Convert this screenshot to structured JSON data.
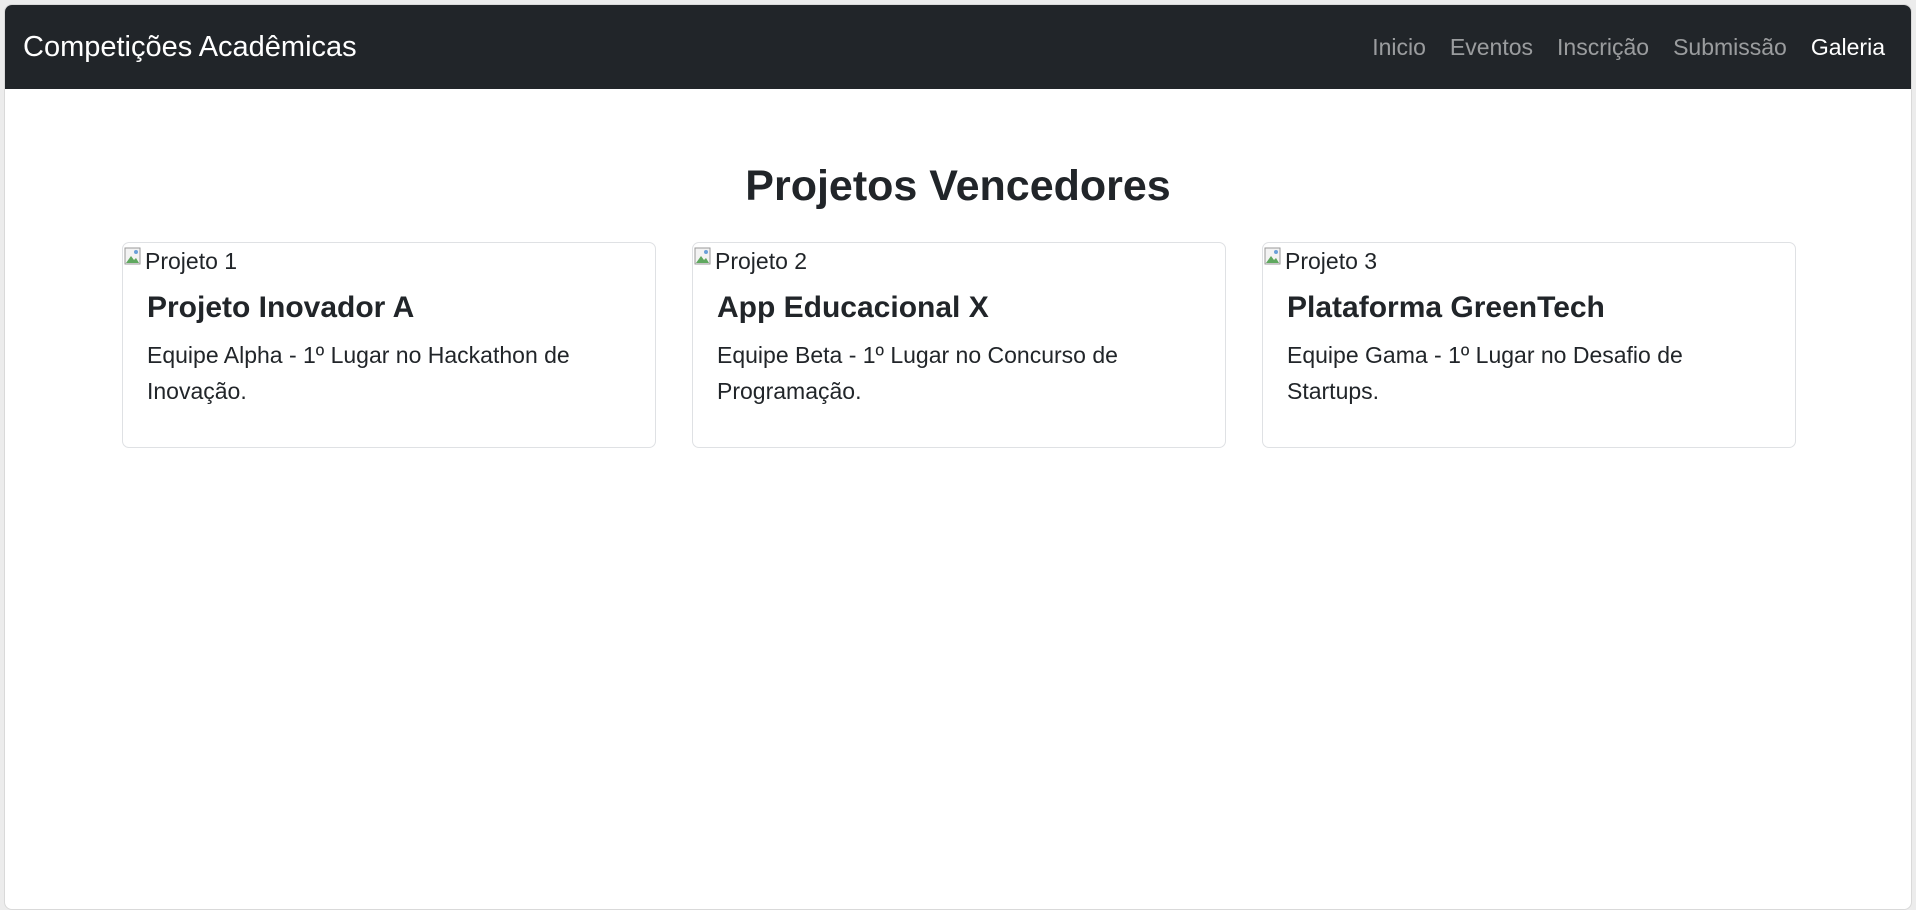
{
  "navbar": {
    "brand": "Competições Acadêmicas",
    "links": [
      {
        "label": "Inicio",
        "active": false
      },
      {
        "label": "Eventos",
        "active": false
      },
      {
        "label": "Inscrição",
        "active": false
      },
      {
        "label": "Submissão",
        "active": false
      },
      {
        "label": "Galeria",
        "active": true
      }
    ]
  },
  "main": {
    "title": "Projetos Vencedores",
    "cards": [
      {
        "image_alt": "Projeto 1",
        "title": "Projeto Inovador A",
        "text": "Equipe Alpha - 1º Lugar no Hackathon de Inovação."
      },
      {
        "image_alt": "Projeto 2",
        "title": "App Educacional X",
        "text": "Equipe Beta - 1º Lugar no Concurso de Programação."
      },
      {
        "image_alt": "Projeto 3",
        "title": "Plataforma GreenTech",
        "text": "Equipe Gama - 1º Lugar no Desafio de Startups."
      }
    ]
  },
  "colors": {
    "navbar_bg": "#212529",
    "nav_link": "rgba(255,255,255,0.55)",
    "nav_link_active": "#ffffff",
    "text": "#212529"
  }
}
